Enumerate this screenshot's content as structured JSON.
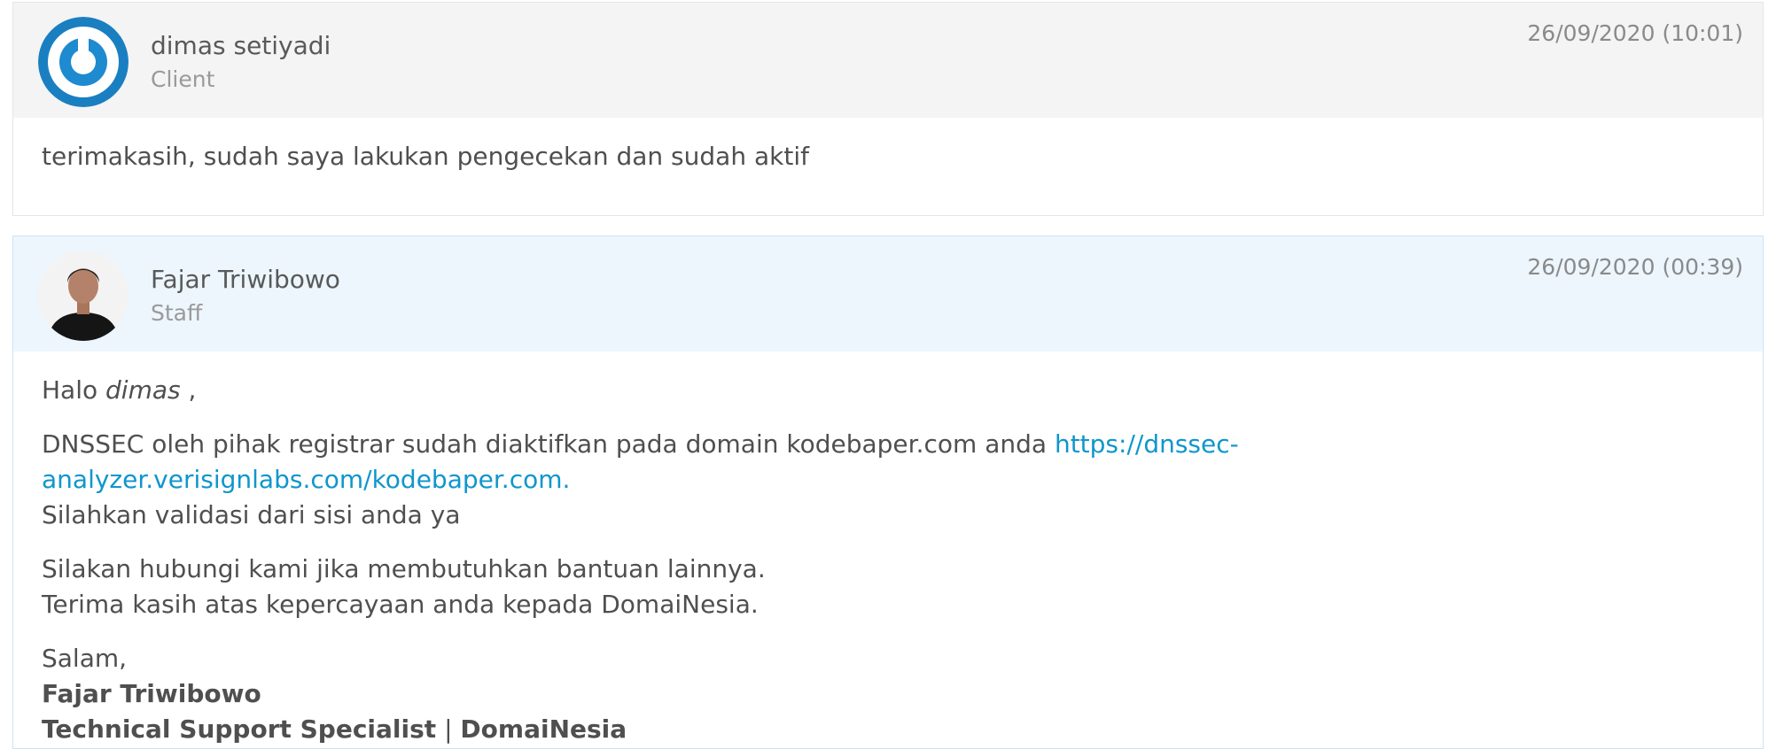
{
  "messages": [
    {
      "author": "dimas setiyadi",
      "role": "Client",
      "date": "26/09/2020 (10:01)",
      "avatar_icon": "power-logo-icon",
      "body": "terimakasih, sudah saya lakukan pengecekan dan sudah aktif"
    },
    {
      "author": "Fajar Triwibowo",
      "role": "Staff",
      "date": "26/09/2020 (00:39)",
      "avatar_icon": "staff-photo-avatar",
      "greeting_prefix": "Halo",
      "greeting_name": "dimas",
      "greeting_suffix": ",",
      "para1_text": "DNSSEC oleh pihak registrar sudah diaktifkan pada domain kodebaper.com anda",
      "para1_link": "https://dnssec-analyzer.verisignlabs.com/kodebaper.com.",
      "para1_line2": "Silahkan validasi dari sisi anda ya",
      "para2_line1": "Silakan hubungi kami jika membutuhkan bantuan lainnya.",
      "para2_line2": "Terima kasih atas kepercayaan anda kepada DomaiNesia.",
      "closing": "Salam,",
      "signature_name": "Fajar Triwibowo",
      "signature_title": "Technical Support Specialist",
      "signature_separator": "|",
      "signature_company": "DomaiNesia"
    }
  ],
  "colors": {
    "link": "#0f96cd",
    "client_header_bg": "#f4f4f4",
    "staff_header_bg": "#edf6fd",
    "logo_blue": "#1a7fc1"
  }
}
